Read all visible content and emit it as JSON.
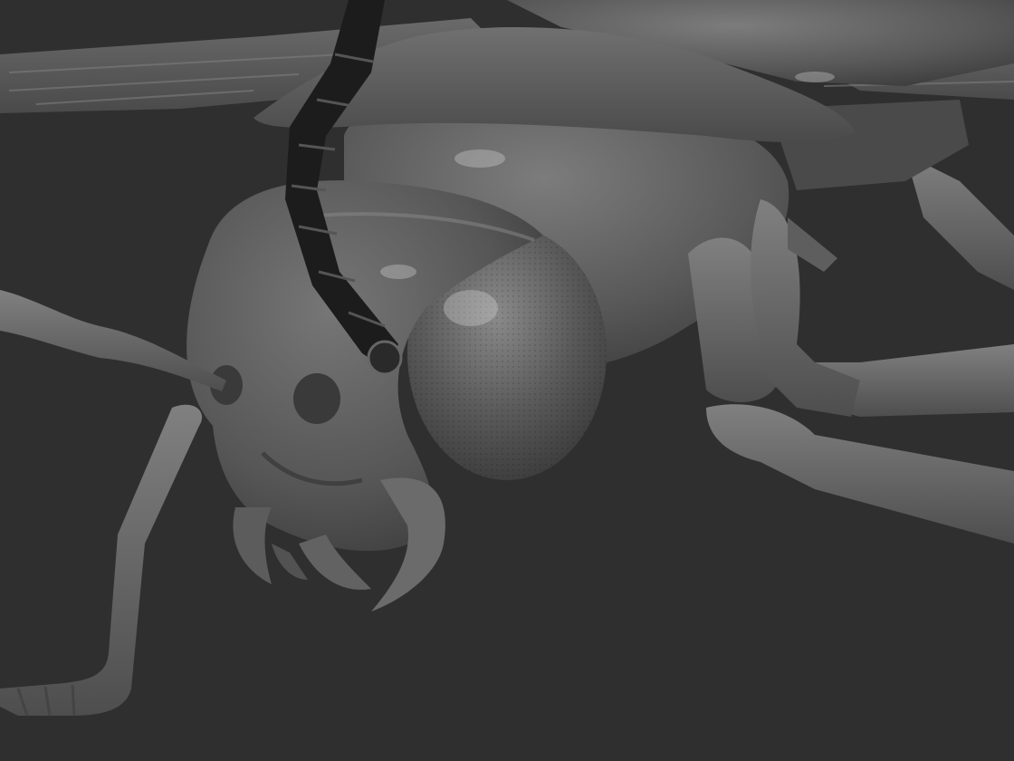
{
  "scene": {
    "subject": "insect-head-sculpt",
    "palette": {
      "background": "#2f2f2f",
      "clay_light": "#7a7a7a",
      "clay_mid": "#5c5c5c",
      "clay_dark": "#3b3b3b",
      "antenna": "#1b1b1b",
      "highlight": "#cfcfcf"
    }
  }
}
